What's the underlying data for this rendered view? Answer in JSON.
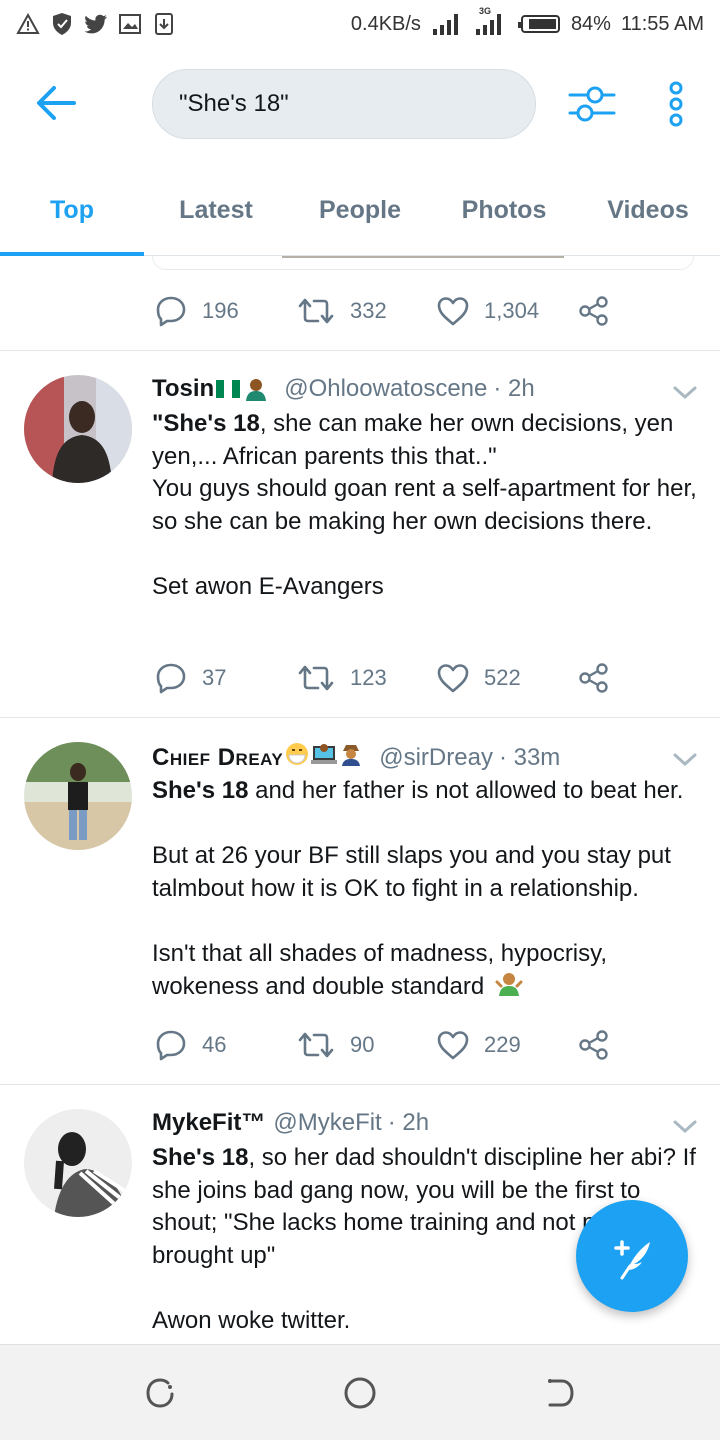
{
  "status_bar": {
    "net_speed": "0.4KB/s",
    "network_type": "3G",
    "battery": "84%",
    "time": "11:55 AM"
  },
  "header": {
    "search_query": "\"She's 18\""
  },
  "tabs": [
    {
      "label": "Top",
      "active": true
    },
    {
      "label": "Latest",
      "active": false
    },
    {
      "label": "People",
      "active": false
    },
    {
      "label": "Photos",
      "active": false
    },
    {
      "label": "Videos",
      "active": false
    }
  ],
  "prev_tweet": {
    "replies": "196",
    "retweets": "332",
    "likes": "1,304"
  },
  "tweets": [
    {
      "name": "Tosin",
      "handle": "@Ohloowatoscene",
      "time": "· 2h",
      "body_bold": "\"She's 18",
      "body_lines": [
        ", she can make her own decisions, yen yen,... African parents this that..\"",
        "You guys should goan rent a self-apartment for her, so she can be making her own decisions there.",
        "Set awon E-Avangers"
      ],
      "replies": "37",
      "retweets": "123",
      "likes": "522"
    },
    {
      "name": "Chief Dreay",
      "handle": "@sirDreay",
      "time": "· 33m",
      "body_bold": "She's 18",
      "body_lines": [
        " and her father is not allowed to beat her.",
        "But at 26 your BF still slaps you and you stay put talmbout how it is OK to fight in a relationship.",
        "Isn't that all shades of madness, hypocrisy, wokeness and double standard"
      ],
      "replies": "46",
      "retweets": "90",
      "likes": "229"
    },
    {
      "name": "MykeFit™",
      "handle": "@MykeFit",
      "time": "· 2h",
      "body_bold": "She's 18",
      "body_lines": [
        ", so her dad shouldn't discipline her abi? If she joins bad gang now, you will be the first to shout; \"She lacks home training and not properly brought up\"",
        "Awon woke twitter."
      ]
    }
  ],
  "colors": {
    "accent": "#1da1f2",
    "secondary_text": "#657786"
  }
}
